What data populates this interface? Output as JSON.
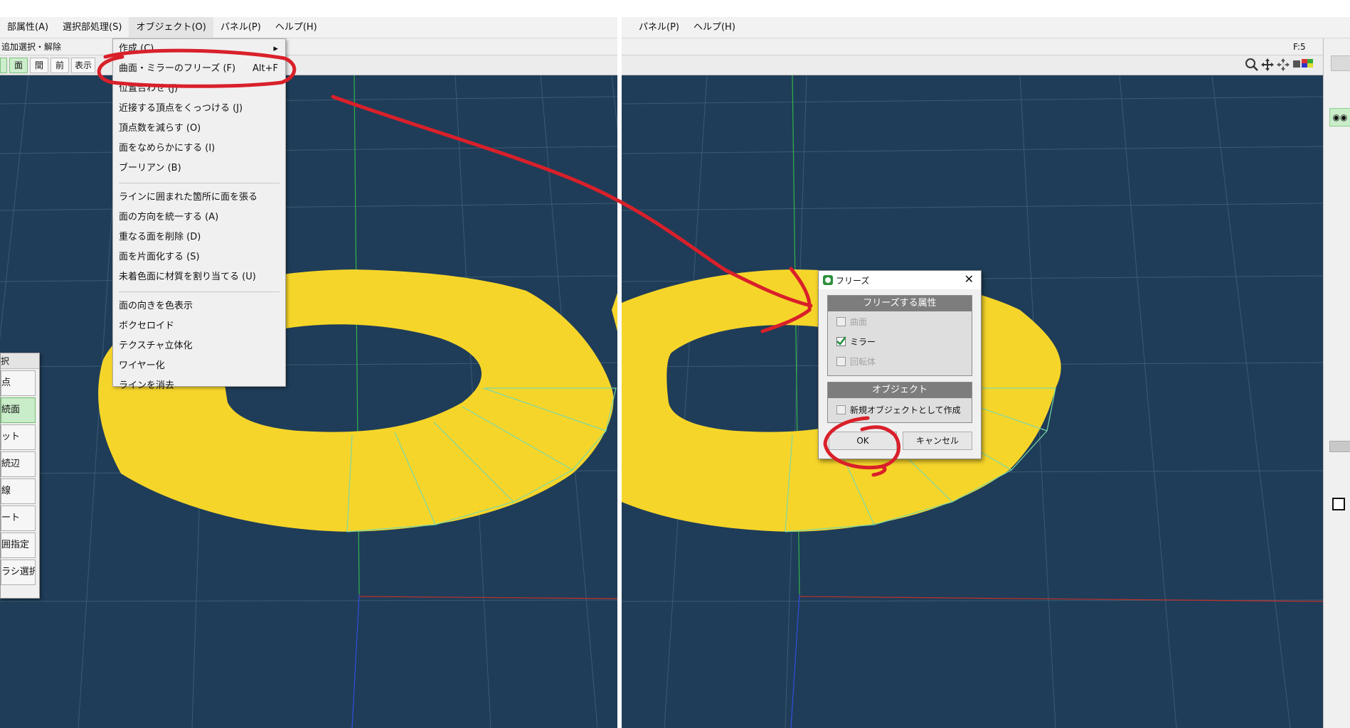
{
  "menubar_left": [
    "部属性(A)",
    "選択部処理(S)",
    "オブジェクト(O)",
    "パネル(P)",
    "ヘルプ(H)"
  ],
  "menubar_right": [
    "パネル(P)",
    "ヘルプ(H)"
  ],
  "toolbar2": {
    "left_text": "追加選択・解除",
    "frame_label": "F:5"
  },
  "toolbar3": {
    "buttons": [
      "面",
      "間",
      "前",
      "表示"
    ]
  },
  "object_menu": {
    "create_label": "作成 (C)",
    "freeze_label": "曲面・ミラーのフリーズ (F)",
    "freeze_shortcut": "Alt+F",
    "align_label": "位置合わせ (J)",
    "group1": [
      "近接する頂点をくっつける (J)",
      "頂点数を減らす (O)",
      "面をなめらかにする (I)",
      "ブーリアン (B)"
    ],
    "group2": [
      "ラインに囲まれた箇所に面を張る",
      "面の方向を統一する (A)",
      "重なる面を削除 (D)",
      "面を片面化する (S)",
      "未着色面に材質を割り当てる (U)"
    ],
    "group3": [
      "面の向きを色表示",
      "ボクセロイド",
      "テクスチャ立体化",
      "ワイヤー化",
      "ラインを消去"
    ]
  },
  "left_panel": {
    "title": "択",
    "items": [
      "点",
      "続面",
      "ット",
      "続辺",
      "線",
      "ート",
      "囲指定",
      "ラシ選択"
    ]
  },
  "freeze_dialog": {
    "title": "フリーズ",
    "attr_group_title": "フリーズする属性",
    "attr_options": [
      {
        "label": "曲面",
        "checked": false,
        "disabled": true
      },
      {
        "label": "ミラー",
        "checked": true,
        "disabled": false
      },
      {
        "label": "回転体",
        "checked": false,
        "disabled": true
      }
    ],
    "object_group_title": "オブジェクト",
    "new_object_label": "新規オブジェクトとして作成",
    "ok_label": "OK",
    "cancel_label": "キャンセル"
  },
  "colors": {
    "viewport_bg": "#1f3d58",
    "ring": "#f6d52a",
    "annotation": "#d9202a",
    "accent_green": "#cdeecd"
  }
}
